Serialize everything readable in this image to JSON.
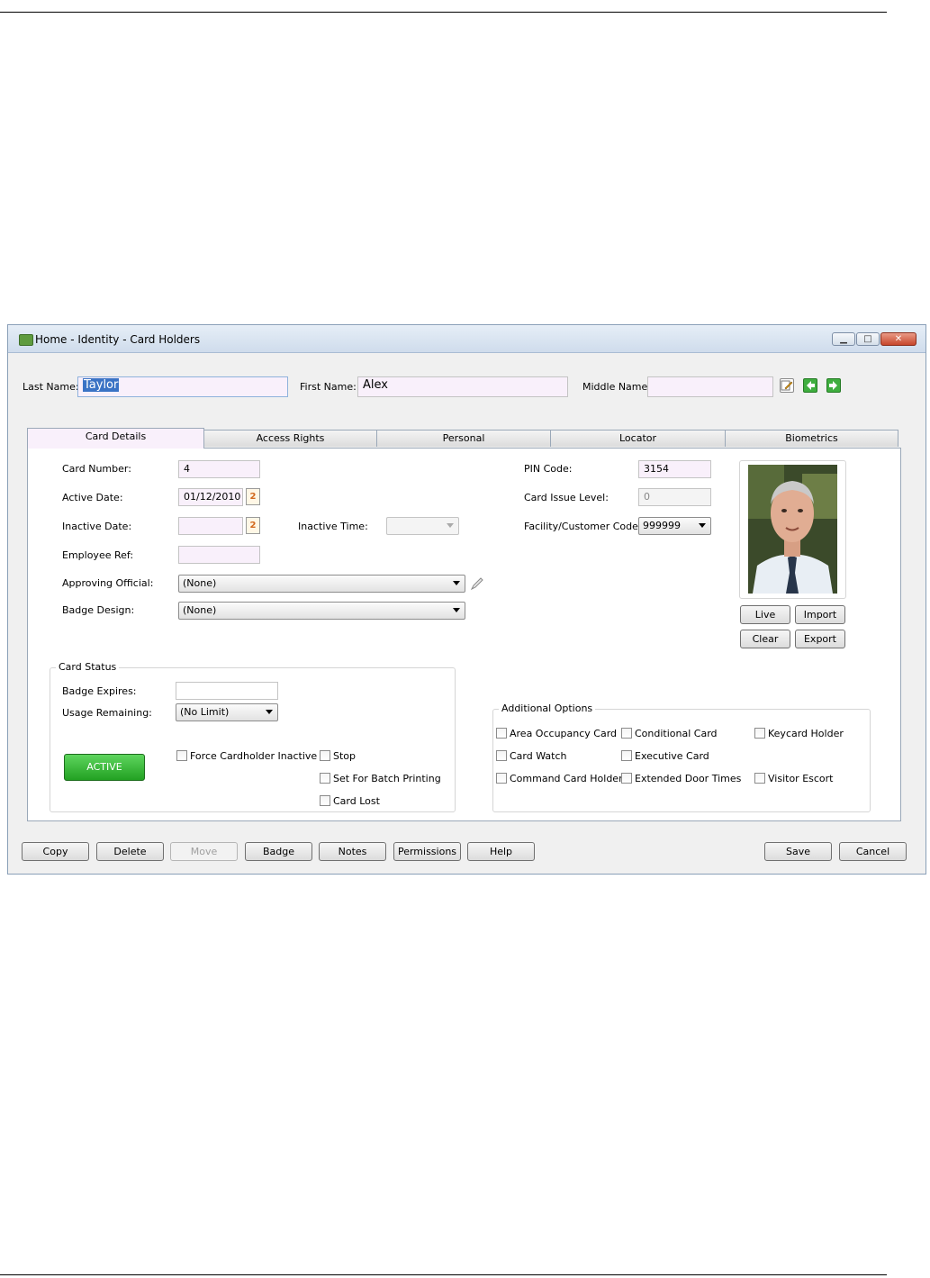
{
  "window": {
    "title": "Home - Identity - Card Holders",
    "minimize_glyph": "▁",
    "maximize_glyph": "□",
    "close_glyph": "✕"
  },
  "name_row": {
    "last_name_label": "Last Name:",
    "last_name_value": "Taylor",
    "first_name_label": "First Name:",
    "first_name_value": "Alex",
    "middle_name_label": "Middle Name:",
    "middle_name_value": ""
  },
  "tabs": [
    {
      "label": "Card Details"
    },
    {
      "label": "Access Rights"
    },
    {
      "label": "Personal"
    },
    {
      "label": "Locator"
    },
    {
      "label": "Biometrics"
    }
  ],
  "card_details": {
    "card_number_label": "Card Number:",
    "card_number_value": "4",
    "active_date_label": "Active Date:",
    "active_date_value": "01/12/2010",
    "inactive_date_label": "Inactive Date:",
    "inactive_date_value": "",
    "inactive_time_label": "Inactive Time:",
    "inactive_time_value": "",
    "employee_ref_label": "Employee Ref:",
    "employee_ref_value": "",
    "approving_official_label": "Approving Official:",
    "approving_official_value": "(None)",
    "badge_design_label": "Badge Design:",
    "badge_design_value": "(None)",
    "pin_code_label": "PIN Code:",
    "pin_code_value": "3154",
    "card_issue_level_label": "Card Issue Level:",
    "card_issue_level_value": "0",
    "facility_code_label": "Facility/Customer Code:",
    "facility_code_value": "999999"
  },
  "photo_buttons": {
    "live": "Live",
    "import": "Import",
    "clear": "Clear",
    "export": "Export"
  },
  "card_status": {
    "title": "Card Status",
    "badge_expires_label": "Badge Expires:",
    "badge_expires_value": "",
    "usage_remaining_label": "Usage Remaining:",
    "usage_remaining_value": "(No Limit)",
    "status_button": "ACTIVE",
    "force_inactive": "Force Cardholder Inactive",
    "stop": "Stop",
    "batch_printing": "Set For Batch Printing",
    "card_lost": "Card Lost"
  },
  "additional_options": {
    "title": "Additional Options",
    "area_occupancy": "Area Occupancy Card",
    "conditional": "Conditional Card",
    "keycard_holder": "Keycard Holder",
    "card_watch": "Card Watch",
    "executive": "Executive Card",
    "command_card": "Command Card Holder",
    "extended_door": "Extended Door Times",
    "visitor_escort": "Visitor Escort"
  },
  "bottom_buttons": {
    "copy": "Copy",
    "delete": "Delete",
    "move": "Move",
    "badge": "Badge",
    "notes": "Notes",
    "permissions": "Permissions",
    "help": "Help",
    "save": "Save",
    "cancel": "Cancel"
  },
  "colors": {
    "field_bg": "#f9f0fb",
    "active_green": "#2fb42f",
    "title_bar": "#dbe6f2"
  }
}
